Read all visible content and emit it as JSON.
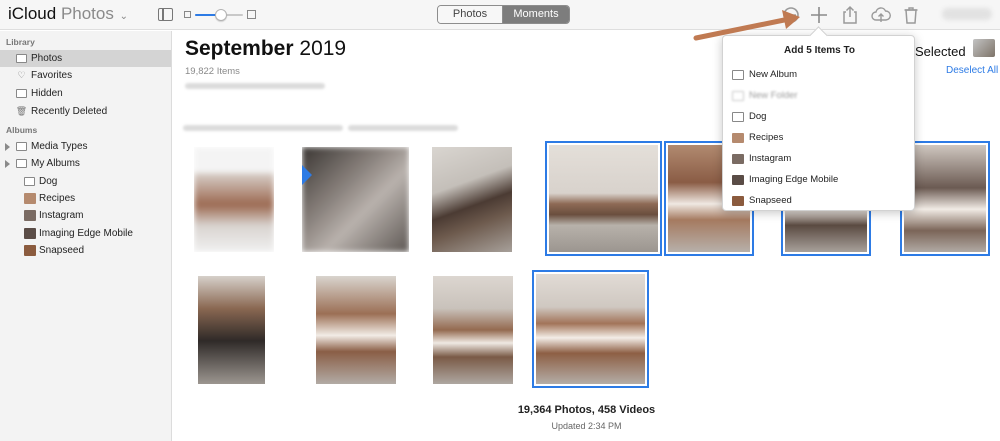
{
  "toolbar": {
    "app_name": "iCloud",
    "app_sub": "Photos",
    "app_chevron": "⌄",
    "segmented": {
      "photos_label": "Photos",
      "moments_label": "Moments",
      "selected": "Moments"
    },
    "zoom_level": 0.55,
    "icons": [
      "sidebar-toggle-icon",
      "smart-album-icon",
      "add-icon",
      "share-icon",
      "upload-icon",
      "trash-icon"
    ]
  },
  "sidebar": {
    "library_header": "Library",
    "library_items": [
      {
        "label": "Photos",
        "icon": "photos-icon",
        "selected": true
      },
      {
        "label": "Favorites",
        "icon": "heart-icon"
      },
      {
        "label": "Hidden",
        "icon": "hidden-icon"
      },
      {
        "label": "Recently Deleted",
        "icon": "trash-icon"
      }
    ],
    "albums_header": "Albums",
    "album_groups": [
      {
        "label": "Media Types",
        "icon": "folder-icon"
      },
      {
        "label": "My Albums",
        "icon": "folder-icon"
      }
    ],
    "albums": [
      {
        "label": "Dog",
        "icon": "folder-icon"
      },
      {
        "label": "Recipes",
        "icon": "album-thumb",
        "color": "#b58a6e"
      },
      {
        "label": "Instagram",
        "icon": "album-thumb",
        "color": "#7a6b63"
      },
      {
        "label": "Imaging Edge Mobile",
        "icon": "album-thumb",
        "color": "#5a4c46"
      },
      {
        "label": "Snapseed",
        "icon": "album-thumb",
        "color": "#8b5b3e"
      }
    ]
  },
  "main": {
    "heading_month": "September",
    "heading_year": "2019",
    "item_count": "19,822 Items",
    "selected_label": "Selected",
    "deselect_all": "Deselect All",
    "footer_count": "19,364 Photos, 458 Videos",
    "footer_updated": "Updated 2:34 PM"
  },
  "popover": {
    "title": "Add 5 Items To",
    "items": [
      {
        "label": "New Album",
        "icon": "folder-icon",
        "disabled": false
      },
      {
        "label": "New Folder",
        "icon": "folder-icon",
        "disabled": true
      },
      {
        "label": "Dog",
        "icon": "folder-icon",
        "disabled": false
      },
      {
        "label": "Recipes",
        "icon": "album-thumb",
        "color": "#b58a6e",
        "disabled": false
      },
      {
        "label": "Instagram",
        "icon": "album-thumb",
        "color": "#7a6b63",
        "disabled": false
      },
      {
        "label": "Imaging Edge Mobile",
        "icon": "album-thumb",
        "color": "#5a4c46",
        "disabled": false
      },
      {
        "label": "Snapseed",
        "icon": "album-thumb",
        "color": "#8b5b3e",
        "disabled": false
      }
    ]
  },
  "photos": [
    {
      "selected": false,
      "blurred": true
    },
    {
      "selected": false,
      "blurred": true
    },
    {
      "selected": false,
      "blurred": false
    },
    {
      "selected": true,
      "blurred": false
    },
    {
      "selected": true,
      "blurred": false
    },
    {
      "selected": true,
      "blurred": false
    },
    {
      "selected": true,
      "blurred": false
    },
    {
      "selected": false,
      "blurred": false
    },
    {
      "selected": false,
      "blurred": false
    },
    {
      "selected": false,
      "blurred": false
    },
    {
      "selected": true,
      "blurred": false
    }
  ],
  "colors": {
    "accent": "#2d7be5",
    "selection_border": "#2d7be5",
    "annotation_arrow": "#c07a52",
    "sidebar_bg": "#f3f3f3",
    "sidebar_selected": "#d4d4d4"
  }
}
